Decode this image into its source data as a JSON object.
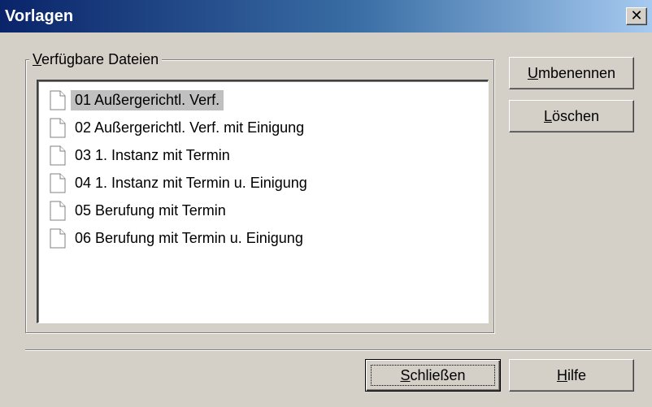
{
  "window": {
    "title": "Vorlagen",
    "close_glyph": "✕"
  },
  "group": {
    "label_mnemonic": "V",
    "label_rest": "erfügbare Dateien"
  },
  "files": [
    {
      "label": "01 Außergerichtl. Verf.",
      "selected": true,
      "icon": "document-icon"
    },
    {
      "label": "02 Außergerichtl. Verf. mit Einigung",
      "selected": false,
      "icon": "document-icon"
    },
    {
      "label": "03 1. Instanz mit Termin",
      "selected": false,
      "icon": "document-icon"
    },
    {
      "label": "04 1. Instanz mit Termin u. Einigung",
      "selected": false,
      "icon": "document-icon"
    },
    {
      "label": "05 Berufung mit Termin",
      "selected": false,
      "icon": "document-icon"
    },
    {
      "label": "06 Berufung mit Termin u. Einigung",
      "selected": false,
      "icon": "document-icon"
    }
  ],
  "buttons": {
    "rename": {
      "mnemonic": "U",
      "rest": "mbenennen"
    },
    "delete": {
      "mnemonic": "L",
      "rest": "öschen"
    },
    "close": {
      "mnemonic": "S",
      "rest": "chließen"
    },
    "help": {
      "mnemonic": "H",
      "rest": "ilfe"
    }
  },
  "colors": {
    "title_gradient_start": "#0a246a",
    "title_gradient_end": "#a6caf0",
    "dialog_bg": "#d4d0c8",
    "selection_bg": "#c0c0c0"
  }
}
